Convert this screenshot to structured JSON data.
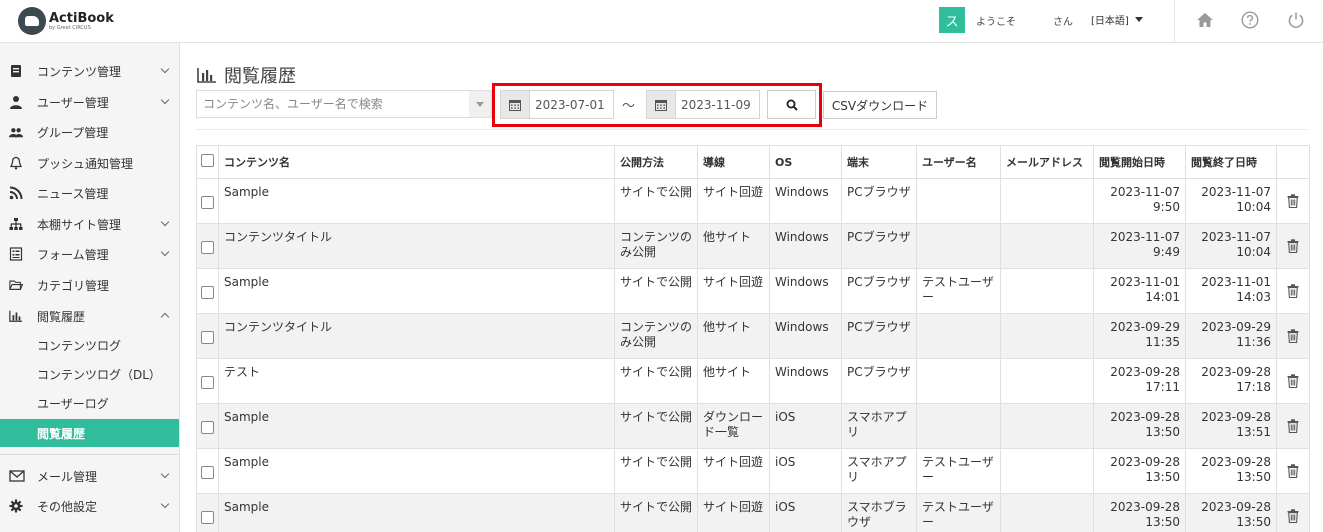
{
  "header": {
    "logo_title": "ActiBook",
    "logo_sub": "by Greet CIRCUS",
    "avatar_char": "ス",
    "welcome": "ようこそ",
    "user_suffix": "さん",
    "language": "[日本語]",
    "icons": [
      "home-icon",
      "help-icon",
      "power-icon"
    ]
  },
  "sidebar": {
    "items": [
      {
        "label": "コンテンツ管理",
        "icon": "book-icon"
      },
      {
        "label": "ユーザー管理",
        "icon": "user-icon"
      },
      {
        "label": "グループ管理",
        "icon": "users-icon"
      },
      {
        "label": "プッシュ通知管理",
        "icon": "bell-icon"
      },
      {
        "label": "ニュース管理",
        "icon": "rss-icon"
      },
      {
        "label": "本棚サイト管理",
        "icon": "sitemap-icon"
      },
      {
        "label": "フォーム管理",
        "icon": "form-icon"
      },
      {
        "label": "カテゴリ管理",
        "icon": "folder-icon"
      },
      {
        "label": "閲覧履歴",
        "icon": "chart-icon"
      },
      {
        "label": "メール管理",
        "icon": "mail-icon"
      },
      {
        "label": "その他設定",
        "icon": "gear-icon"
      }
    ],
    "subitems": [
      {
        "label": "コンテンツログ"
      },
      {
        "label": "コンテンツログ（DL）"
      },
      {
        "label": "ユーザーログ"
      },
      {
        "label": "閲覧履歴"
      }
    ]
  },
  "main": {
    "title": "閲覧履歴",
    "search_placeholder": "コンテンツ名、ユーザー名で検索",
    "date_from": "2023-07-01",
    "date_sep": "～",
    "date_to": "2023-11-09",
    "csv_label": "CSVダウンロード"
  },
  "table": {
    "headers": [
      "コンテンツ名",
      "公開方法",
      "導線",
      "OS",
      "端末",
      "ユーザー名",
      "メールアドレス",
      "閲覧開始日時",
      "閲覧終了日時"
    ],
    "rows": [
      {
        "name": "Sample",
        "method": "サイトで公開",
        "route": "サイト回遊",
        "os": "Windows",
        "device": "PCブラウザ",
        "user": "",
        "email": "",
        "start": "2023-11-07 9:50",
        "end": "2023-11-07 10:04"
      },
      {
        "name": "コンテンツタイトル",
        "method": "コンテンツのみ公開",
        "route": "他サイト",
        "os": "Windows",
        "device": "PCブラウザ",
        "user": "",
        "email": "",
        "start": "2023-11-07 9:49",
        "end": "2023-11-07 10:04"
      },
      {
        "name": "Sample",
        "method": "サイトで公開",
        "route": "サイト回遊",
        "os": "Windows",
        "device": "PCブラウザ",
        "user": "テストユーザー",
        "email": "",
        "start": "2023-11-01 14:01",
        "end": "2023-11-01 14:03"
      },
      {
        "name": "コンテンツタイトル",
        "method": "コンテンツのみ公開",
        "route": "他サイト",
        "os": "Windows",
        "device": "PCブラウザ",
        "user": "",
        "email": "",
        "start": "2023-09-29 11:35",
        "end": "2023-09-29 11:36"
      },
      {
        "name": "テスト",
        "method": "サイトで公開",
        "route": "他サイト",
        "os": "Windows",
        "device": "PCブラウザ",
        "user": "",
        "email": "",
        "start": "2023-09-28 17:11",
        "end": "2023-09-28 17:18"
      },
      {
        "name": "Sample",
        "method": "サイトで公開",
        "route": "ダウンロード一覧",
        "os": "iOS",
        "device": "スマホアプリ",
        "user": "",
        "email": "",
        "start": "2023-09-28 13:50",
        "end": "2023-09-28 13:51"
      },
      {
        "name": "Sample",
        "method": "サイトで公開",
        "route": "サイト回遊",
        "os": "iOS",
        "device": "スマホアプリ",
        "user": "テストユーザー",
        "email": "",
        "start": "2023-09-28 13:50",
        "end": "2023-09-28 13:50"
      },
      {
        "name": "Sample",
        "method": "サイトで公開",
        "route": "サイト回遊",
        "os": "iOS",
        "device": "スマホブラウザ",
        "user": "テストユーザー",
        "email": "",
        "start": "2023-09-28 13:50",
        "end": "2023-09-28 13:50"
      }
    ]
  }
}
